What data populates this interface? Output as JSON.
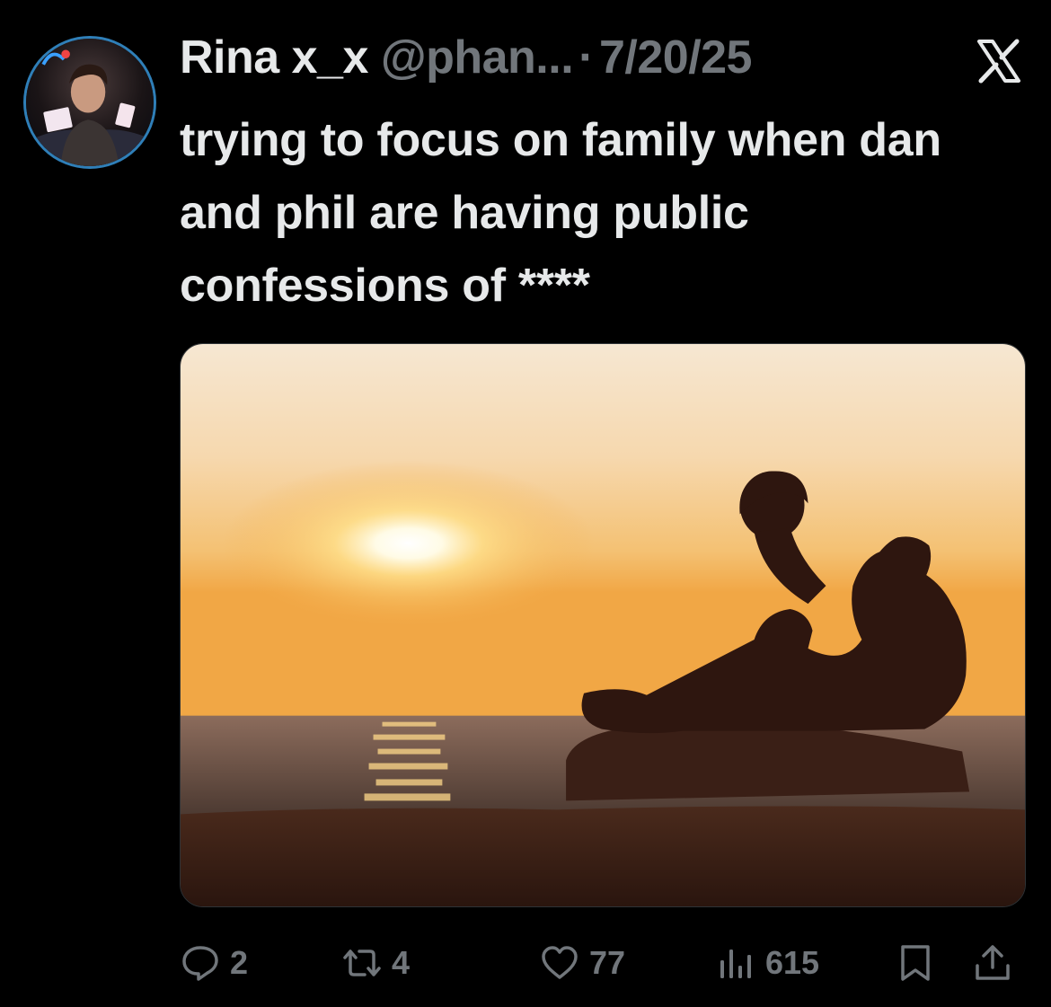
{
  "tweet": {
    "author_name": "Rina x_x",
    "handle": "@phan...",
    "separator": "·",
    "date": "7/20/25",
    "text": "trying to focus on family when dan and phil are having public confessions of ****",
    "platform_icon": "x-logo-icon"
  },
  "media": {
    "description_icon": "photo"
  },
  "actions": {
    "replies": "2",
    "reposts": "4",
    "likes": "77",
    "views": "615"
  },
  "colors": {
    "background": "#000000",
    "primary_text": "#e7e9ea",
    "secondary_text": "#71767b",
    "avatar_ring": "#2f7fb8"
  }
}
